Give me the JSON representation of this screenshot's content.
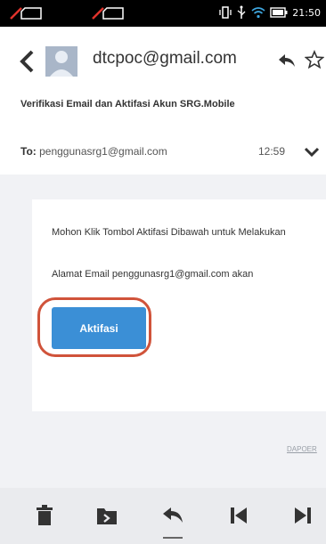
{
  "status_bar": {
    "time": "21:50"
  },
  "header": {
    "sender": "dtcpoc@gmail.com",
    "back_icon": "chevron-left-icon",
    "reply_icon": "reply-icon",
    "star_icon": "star-icon"
  },
  "email": {
    "subject": "Verifikasi Email dan Aktifasi Akun SRG.Mobile",
    "to_label": "To:",
    "to_address": "penggunasrg1@gmail.com",
    "time": "12:59",
    "body_line1": "Mohon Klik Tombol Aktifasi Dibawah untuk Melakukan",
    "body_line2": "Alamat Email penggunasrg1@gmail.com akan",
    "button_label": "Aktifasi",
    "footer_link": "DAPOER"
  },
  "colors": {
    "button": "#3b8fd6",
    "highlight": "#d0533a",
    "body_bg": "#f1f2f5"
  },
  "toolbar": {
    "icons": [
      "trash-icon",
      "move-to-folder-icon",
      "reply-icon",
      "previous-icon",
      "next-icon"
    ]
  }
}
